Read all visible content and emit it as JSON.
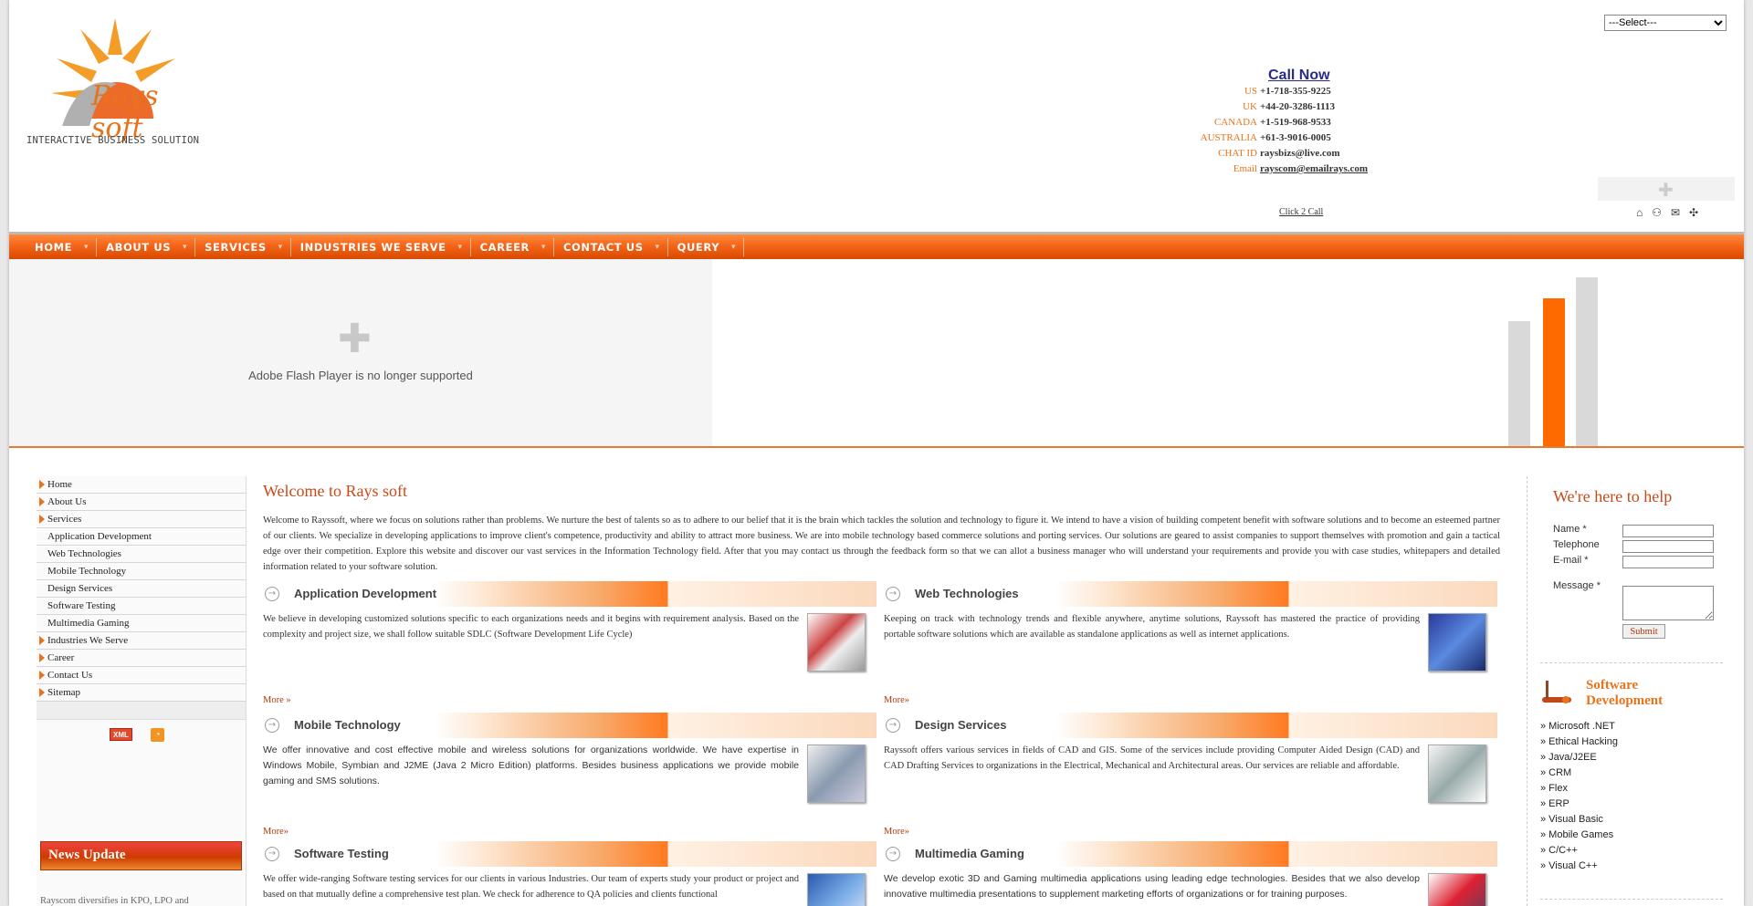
{
  "header": {
    "logo_text": "Rays soft",
    "tagline": "INTERACTIVE BUSINESS SOLUTION",
    "language_select": "---Select---",
    "call_now": "Call Now",
    "contacts": [
      {
        "label": "US",
        "value": "+1-718-355-9225",
        "style": "bold"
      },
      {
        "label": "UK",
        "value": "+44-20-3286-1113",
        "style": "bold"
      },
      {
        "label": "CANADA",
        "value": "+1-519-968-9533",
        "style": "bold"
      },
      {
        "label": "AUSTRALIA",
        "value": "+61-3-9016-0005",
        "style": "bold"
      },
      {
        "label": "CHAT ID",
        "value": "raysbizs@live.com",
        "style": "bold"
      },
      {
        "label": "Email",
        "value": "rayscom@emailrays.com",
        "style": "link"
      }
    ],
    "click2call": "Click 2 Call"
  },
  "nav": [
    "HOME",
    "ABOUT US",
    "SERVICES",
    "INDUSTRIES WE SERVE",
    "CAREER",
    "CONTACT US",
    "QUERY"
  ],
  "banner": {
    "flash_message": "Adobe Flash Player is no longer supported"
  },
  "sidebar": {
    "items": [
      {
        "label": "Home",
        "arrow": true
      },
      {
        "label": "About Us",
        "arrow": true
      },
      {
        "label": "Services",
        "arrow": true
      },
      {
        "label": "Application Development",
        "arrow": false
      },
      {
        "label": "Web Technologies",
        "arrow": false
      },
      {
        "label": "Mobile Technology",
        "arrow": false
      },
      {
        "label": "Design Services",
        "arrow": false
      },
      {
        "label": "Software Testing",
        "arrow": false
      },
      {
        "label": "Multimedia Gaming",
        "arrow": false
      },
      {
        "label": "Industries We Serve",
        "arrow": true
      },
      {
        "label": "Career",
        "arrow": true
      },
      {
        "label": "Contact Us",
        "arrow": true
      },
      {
        "label": "Sitemap",
        "arrow": true
      }
    ],
    "xml_label": "XML",
    "news_title": "News Update",
    "news_text": "Rayscom diversifies in KPO, LPO and"
  },
  "main": {
    "welcome_title": "Welcome to Rays soft",
    "intro": "Welcome to Rayssoft, where we focus on solutions rather than problems. We nurture the best of talents so as to adhere to our belief that it is the brain which tackles the solution and technology to figure it. We intend to have a vision of building competent benefit with software solutions and to become an esteemed partner of our clients. We specialize in developing applications to improve client's competence, productivity and ability to attract more business. We are into mobile technology based commerce solutions and porting services. Our solutions are geared to assist companies to support themselves with promotion and gain a tactical edge over their competition. Explore this website and discover our vast services in the Information Technology field. After that you may contact us through the feedback form so that we can allot a business manager who will understand your requirements and provide you with case studies, whitepapers and detailed information related to your software solution.",
    "services": [
      {
        "title": "Application Development",
        "text": "We believe in developing customized solutions specific to each organizations needs and it begins with requirement analysis. Based on the complexity and project size, we shall follow suitable SDLC (Software Development Life Cycle)",
        "more": "More »"
      },
      {
        "title": "Web Technologies",
        "text": "Keeping on track with technology trends and flexible anywhere, anytime solutions, Rayssoft has mastered the practice of providing portable software solutions which are available as standalone applications as well as internet applications.",
        "more": "More»"
      },
      {
        "title": "Mobile Technology",
        "text": " We offer innovative and cost effective mobile and wireless solutions for organizations worldwide. We have expertise in Windows Mobile, Symbian and J2ME (Java 2 Micro Edition) platforms. Besides business applications we provide mobile gaming and SMS solutions.",
        "more": "More»"
      },
      {
        "title": "Design Services",
        "text": "Rayssoft offers various services in fields of CAD and GIS. Some of the services include providing Computer Aided Design (CAD) and CAD Drafting Services to organizations in the Electrical, Mechanical and Architectural areas. Our services are reliable and affordable.",
        "more": "More»"
      },
      {
        "title": "Software Testing",
        "text": "We offer wide-ranging Software testing services for our clients in various Industries. Our team of experts study your product or project and based on that mutually define a comprehensive test plan. We check for adherence to QA policies and clients functional",
        "more": ""
      },
      {
        "title": "Multimedia Gaming",
        "text": " We develop exotic 3D and Gaming multimedia applications using leading edge technologies. Besides that we also develop innovative multimedia presentations to supplement marketing efforts of organizations or for training purposes.",
        "more": ""
      }
    ]
  },
  "right_sidebar": {
    "help_title": "We're here to help",
    "form": {
      "name_label": "Name  *",
      "telephone_label": "Telephone",
      "email_label": "E-mail  *",
      "message_label": "Message  *",
      "submit_label": "Submit"
    },
    "sd_title_line1": "Software",
    "sd_title_line2": "Development",
    "sd_items": [
      "» Microsoft .NET",
      "» Ethical Hacking",
      "» Java/J2EE",
      "» CRM",
      "» Flex",
      "» ERP",
      "» Visual Basic",
      "» Mobile Games",
      "» C/C++",
      "» Visual C++"
    ]
  },
  "colors": {
    "accent": "#e8731a",
    "nav_orange": "#f4651a",
    "title_red": "#c94a1a"
  }
}
